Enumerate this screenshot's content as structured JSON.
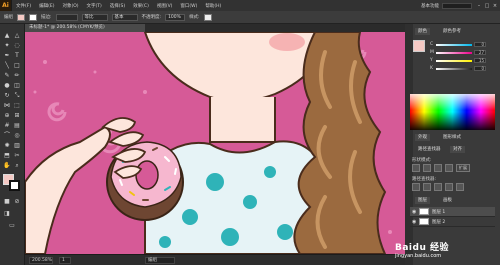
{
  "app": {
    "logo": "Ai",
    "workspace": "基本功能"
  },
  "menu": [
    "文件(F)",
    "编辑(E)",
    "对象(O)",
    "文字(T)",
    "选择(S)",
    "效果(C)",
    "视图(V)",
    "窗口(W)",
    "帮助(H)"
  ],
  "control_bar": {
    "object_label": "编组",
    "stroke_label": "描边:",
    "stroke_value": "等比",
    "style_value": "基本",
    "opacity_label": "不透明度:",
    "opacity_value": "100%",
    "style_label": "样式:",
    "fill_color": "#f4c9c4"
  },
  "document": {
    "tab_title": "未标题-1* @ 200.58% (CMYK/预览)"
  },
  "status": {
    "zoom": "200.58%",
    "page": "1",
    "tool": "编组"
  },
  "panels": {
    "color_tabs": [
      "颜色",
      "颜色参考"
    ],
    "sliders": [
      {
        "label": "C",
        "value": "0",
        "color": "#00b7eb"
      },
      {
        "label": "M",
        "value": "27",
        "color": "#ec008c"
      },
      {
        "label": "Y",
        "value": "15",
        "color": "#fff200"
      },
      {
        "label": "K",
        "value": "0",
        "color": "#222222"
      }
    ],
    "appearance_tabs": [
      "外观",
      "图形样式"
    ],
    "align_tabs": [
      "路径查找器",
      "对齐"
    ],
    "shape_modes_label": "形状模式:",
    "pathfinder_label": "路径查找器:",
    "expand_button": "扩展",
    "layers_tabs": [
      "图层",
      "画板"
    ],
    "layers": [
      {
        "name": "图层 1",
        "selected": true
      },
      {
        "name": "图层 2",
        "selected": false
      }
    ]
  },
  "watermark": {
    "brand": "Baidu 经验",
    "url": "jingyan.baidu.com"
  },
  "colors": {
    "canvas_bg": "#d65a97",
    "skin": "#fde6dc",
    "hair": "#9b6a3f",
    "donut_icing": "#f6b7cf",
    "donut_dough": "#6e4632",
    "dots": "#2fb3b8"
  }
}
